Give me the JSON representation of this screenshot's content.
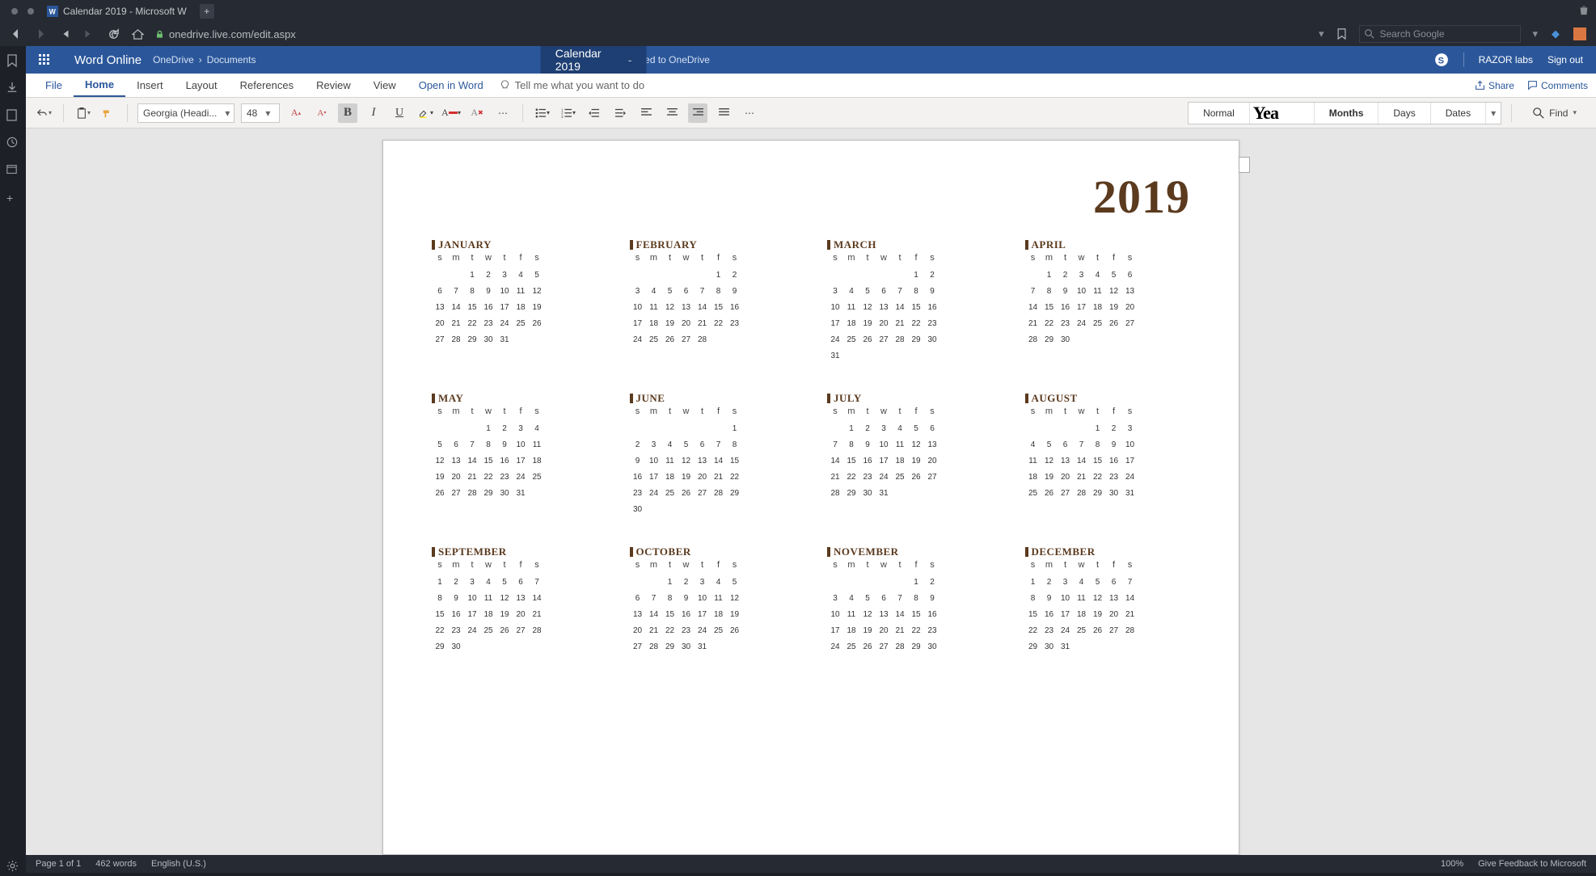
{
  "browser": {
    "tab_title": "Calendar 2019 - Microsoft W",
    "url": "onedrive.live.com/edit.aspx",
    "search_placeholder": "Search Google"
  },
  "bluebar": {
    "app_title": "Word Online",
    "crumb1": "OneDrive",
    "crumb2": "Documents",
    "doc_title": "Calendar 2019",
    "saved": "Saved to OneDrive",
    "user": "RAZOR labs",
    "signout": "Sign out"
  },
  "tabs": {
    "file": "File",
    "home": "Home",
    "insert": "Insert",
    "layout": "Layout",
    "references": "References",
    "review": "Review",
    "view": "View",
    "open_in_word": "Open in Word",
    "tell_me": "Tell me what you want to do",
    "share": "Share",
    "comments": "Comments"
  },
  "ribbon": {
    "font": "Georgia (Headi...",
    "size": "48",
    "style_normal": "Normal",
    "style_year_thumb": "Yea",
    "style_months": "Months",
    "style_days": "Days",
    "style_dates": "Dates",
    "find": "Find"
  },
  "document": {
    "year": "2019",
    "dow": [
      "s",
      "m",
      "t",
      "w",
      "t",
      "f",
      "s"
    ],
    "months": [
      {
        "name": "JANUARY",
        "start": 2,
        "len": 31
      },
      {
        "name": "FEBRUARY",
        "start": 5,
        "len": 28
      },
      {
        "name": "MARCH",
        "start": 5,
        "len": 31
      },
      {
        "name": "APRIL",
        "start": 1,
        "len": 30
      },
      {
        "name": "MAY",
        "start": 3,
        "len": 31
      },
      {
        "name": "JUNE",
        "start": 6,
        "len": 30
      },
      {
        "name": "JULY",
        "start": 1,
        "len": 31
      },
      {
        "name": "AUGUST",
        "start": 4,
        "len": 31
      },
      {
        "name": "SEPTEMBER",
        "start": 0,
        "len": 30
      },
      {
        "name": "OCTOBER",
        "start": 2,
        "len": 31
      },
      {
        "name": "NOVEMBER",
        "start": 5,
        "len": 30
      },
      {
        "name": "DECEMBER",
        "start": 0,
        "len": 31
      }
    ]
  },
  "status": {
    "page": "Page 1 of 1",
    "words": "462 words",
    "lang": "English (U.S.)",
    "zoom": "100%",
    "feedback": "Give Feedback to Microsoft"
  }
}
